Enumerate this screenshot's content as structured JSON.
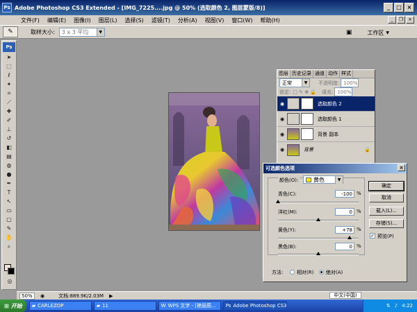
{
  "window": {
    "title": "Adobe Photoshop CS3 Extended - [IMG_7225....jpg @ 50% (选取颜色 2, 图层蒙版/8)]"
  },
  "menu": [
    "文件(F)",
    "编辑(E)",
    "图像(I)",
    "图层(L)",
    "选择(S)",
    "滤镜(T)",
    "分析(A)",
    "视图(V)",
    "窗口(W)",
    "帮助(H)"
  ],
  "options": {
    "sample_size_label": "取样大小:",
    "sample_size_value": "3 x 3 平均",
    "workspace_label": "工作区"
  },
  "toolbox": {
    "logo": "Ps"
  },
  "layers_panel": {
    "tabs": [
      "图层",
      "历史记录",
      "通道",
      "动作",
      "样式"
    ],
    "blend_mode": "正常",
    "opacity_label": "不透明度:",
    "opacity_value": "100%",
    "lock_label": "锁定:",
    "fill_label": "填充:",
    "fill_value": "100%",
    "layers": [
      {
        "name": "选取颜色 2",
        "selected": true
      },
      {
        "name": "选取颜色 1",
        "selected": false
      },
      {
        "name": "背景 副本",
        "selected": false
      },
      {
        "name": "背景",
        "selected": false
      }
    ]
  },
  "dialog": {
    "title": "可选颜色选项",
    "colors_label": "颜色(O):",
    "colors_value": "黄色",
    "sliders": [
      {
        "label": "青色(C):",
        "value": "-100",
        "pct": "%",
        "level": -100
      },
      {
        "label": "洋红(M):",
        "value": "0",
        "pct": "%",
        "level": 0
      },
      {
        "label": "黄色(Y):",
        "value": "+78",
        "pct": "%",
        "level": 78
      },
      {
        "label": "黑色(B):",
        "value": "0",
        "pct": "%",
        "level": 0
      }
    ],
    "buttons": {
      "ok": "确定",
      "cancel": "取消",
      "load": "载入(L)...",
      "save": "存储(S)..."
    },
    "preview_label": "预览(P)",
    "method_label": "方法:",
    "method_relative": "相对(R)",
    "method_absolute": "绝对(A)"
  },
  "status": {
    "zoom": "50%",
    "doc": "文档:889.9K/2.03M"
  },
  "taskbar": {
    "start": "开始",
    "tasks": [
      "CARLEZOP",
      "11",
      "WPS 文字 - [艳丽质...",
      "Adobe Photoshop CS3..."
    ],
    "ime": "中文(中国)",
    "time": "4:22"
  }
}
